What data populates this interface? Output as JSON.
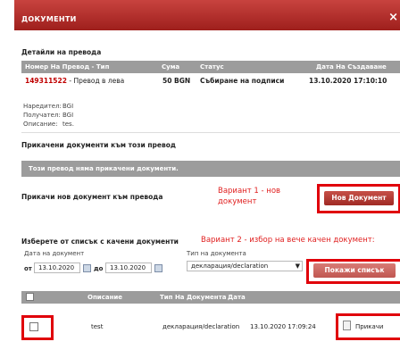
{
  "dialog": {
    "title": "ДОКУМЕНТИ",
    "close": "×"
  },
  "details": {
    "heading": "Детайли на превода",
    "columns": [
      "Номер На Превод - Тип",
      "Сума",
      "Статус",
      "Дата На Създаване"
    ],
    "row": {
      "number": "149311522",
      "type": " - Превод в лева",
      "amount": "50 BGN",
      "status": "Събиране на подписи",
      "created": "13.10.2020 17:10:10"
    },
    "meta": [
      {
        "label": "Наредител:",
        "value": "BGI"
      },
      {
        "label": "Получател:",
        "value": "BGI"
      },
      {
        "label": "Описание:",
        "value": "tes."
      }
    ]
  },
  "attached": {
    "heading": "Прикачени документи към този превод",
    "empty": "Този превод няма прикачени документи."
  },
  "attach_new": {
    "label": "Прикачи нов документ към превода",
    "variant": "Вариант 1 - нов документ",
    "button": "Нов Документ"
  },
  "from_list": {
    "label": "Изберете от списък с качени документи",
    "variant": "Вариант 2 - избор на вече качен документ:",
    "date_label": "Дата на документ",
    "from_label": "от",
    "date_from": "13.10.2020",
    "to_label": "до",
    "date_to": "13.10.2020",
    "type_label": "Тип на документа",
    "type_value": "декларация/declaration",
    "show_button": "Покажи списък"
  },
  "docs_table": {
    "columns": [
      "Описание",
      "Тип На Документа",
      "Дата"
    ],
    "row": {
      "description": "test",
      "type": "декларация/declaration",
      "date": "13.10.2020 17:09:24",
      "action": "Прикачи"
    }
  },
  "colors": {
    "accent": "#a8261f",
    "red_outline": "#e0000a",
    "gray_header": "#9c9c9c"
  }
}
